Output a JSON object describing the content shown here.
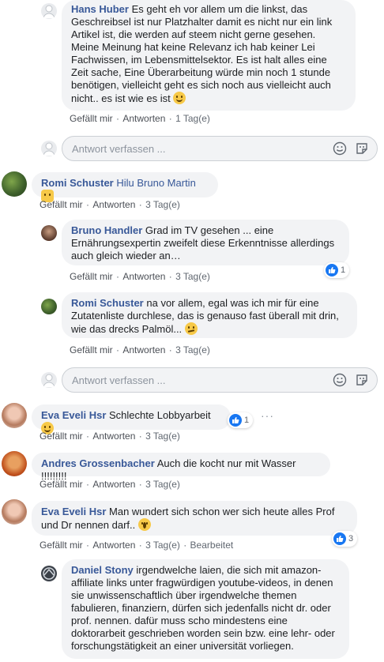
{
  "comments": [
    {
      "author": "Hans Huber",
      "text": "Es geht eh vor allem um die linkst, das Geschreibsel ist nur Platzhalter damit es nicht nur ein link Artikel ist, die werden auf steem nicht gerne gesehen. Meine Meinung hat keine Relevanz ich hab keiner Lei Fachwissen, im Lebensmittelsektor. Es ist halt alles eine Zeit sache, Eine Überarbeitung würde min noch 1 stunde benötigen, vielleicht geht es sich noch aus vielleicht auch nicht.. es ist wie es ist",
      "like": "Gefällt mir",
      "reply": "Antworten",
      "time": "1 Tag(e)"
    },
    {
      "author": "Romi Schuster",
      "text": "Hilu Bruno Martin",
      "like": "Gefällt mir",
      "reply": "Antworten",
      "time": "3 Tag(e)"
    },
    {
      "author": "Bruno Handler",
      "text": "Grad im TV gesehen ... eine Ernährungsexpertin zweifelt diese Erkenntnisse allerdings auch gleich wieder an…",
      "like": "Gefällt mir",
      "reply": "Antworten",
      "time": "3 Tag(e)",
      "reactions": "1"
    },
    {
      "author": "Romi Schuster",
      "text": "na vor allem, egal was ich mir für eine Zutatenliste durchlese, das is genauso fast überall mit drin, wie das drecks Palmöl...",
      "like": "Gefällt mir",
      "reply": "Antworten",
      "time": "3 Tag(e)"
    },
    {
      "author": "Eva Eveli Hsr",
      "text": "Schlechte Lobbyarbeit",
      "like": "Gefällt mir",
      "reply": "Antworten",
      "time": "3 Tag(e)",
      "reactions": "1"
    },
    {
      "author": "Andres Grossenbacher",
      "text": "Auch die kocht nur mit Wasser !!!!!!!!!",
      "like": "Gefällt mir",
      "reply": "Antworten",
      "time": "3 Tag(e)"
    },
    {
      "author": "Eva Eveli Hsr",
      "text": "Man wundert sich schon wer sich heute alles Prof und Dr nennen darf..",
      "like": "Gefällt mir",
      "reply": "Antworten",
      "time": "3 Tag(e)",
      "edited": "Bearbeitet",
      "reactions": "3"
    },
    {
      "author": "Daniel Stony",
      "text": "irgendwelche laien, die sich mit amazon-affiliate links unter fragwürdigen youtube-videos, in denen sie unwissenschaftlich über irgendwelche themen fabulieren, finanziern, dürfen sich jedenfalls nicht dr. oder prof. nennen. dafür muss scho mindestens eine doktorarbeit geschrieben worden sein bzw. eine lehr- oder forschungstätigkeit an einer universität vorliegen."
    }
  ],
  "reply_placeholder": "Antwort verfassen ...",
  "colors": {
    "link": "#385898",
    "bubble": "#f2f3f5",
    "like_blue": "#1877f2"
  }
}
